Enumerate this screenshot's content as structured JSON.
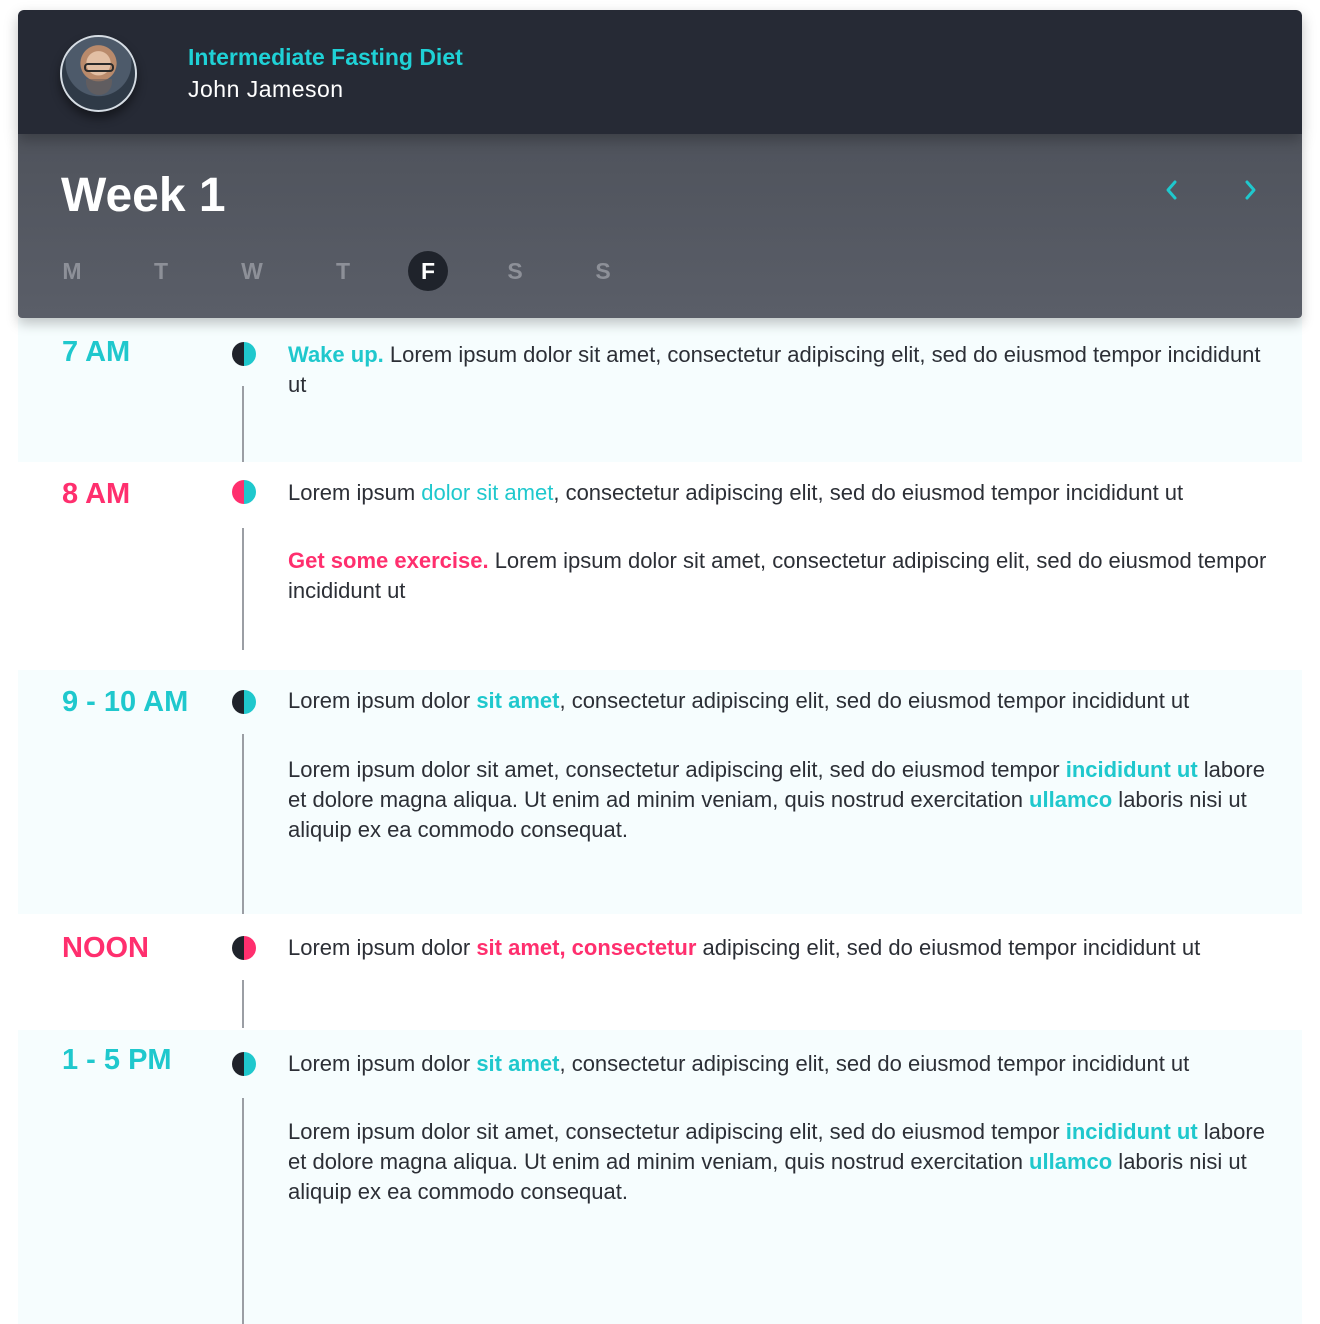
{
  "header": {
    "title": "Intermediate Fasting Diet",
    "name": "John Jameson"
  },
  "week": {
    "title": "Week 1",
    "days": [
      "M",
      "T",
      "W",
      "T",
      "F",
      "S",
      "S"
    ],
    "active_day": "F"
  },
  "colors": {
    "teal": "#1fc8cd",
    "pink": "#ff2f6e",
    "dark": "#262a35"
  },
  "icons": {
    "prev": "chevron-left-icon",
    "next": "chevron-right-icon"
  },
  "schedule": {
    "r0": {
      "time": "7 AM",
      "p0": {
        "a": "Wake up.",
        "b": " Lorem ipsum dolor sit amet, consectetur adipiscing elit, sed do eiusmod tempor incididunt ut"
      }
    },
    "r1": {
      "time": "8 AM",
      "p0": {
        "a": "Lorem ipsum ",
        "b": "dolor sit amet",
        "c": ", consectetur adipiscing elit, sed do eiusmod tempor incididunt ut"
      },
      "p1": {
        "a": "Get some exercise.",
        "b": " Lorem ipsum dolor sit amet, consectetur adipiscing elit, sed do eiusmod tempor incididunt ut"
      }
    },
    "r2": {
      "time": "9 - 10 AM",
      "p0": {
        "a": "Lorem ipsum dolor ",
        "b": "sit amet",
        "c": ", consectetur adipiscing elit, sed do eiusmod tempor incididunt ut"
      },
      "p1": {
        "a": "Lorem ipsum dolor sit amet, consectetur adipiscing elit, sed do eiusmod tempor ",
        "b": "incididunt ut",
        "c": " labore et dolore magna aliqua. Ut enim ad minim veniam, quis nostrud exercitation ",
        "d": "ullamco",
        "e": " laboris nisi ut aliquip ex ea commodo consequat."
      }
    },
    "r3": {
      "time": "NOON",
      "p0": {
        "a": "Lorem ipsum dolor ",
        "b": "sit amet, consectetur",
        "c": " adipiscing elit, sed do eiusmod tempor incididunt ut"
      }
    },
    "r4": {
      "time": "1 - 5 PM",
      "p0": {
        "a": "Lorem ipsum dolor ",
        "b": "sit amet",
        "c": ", consectetur adipiscing elit, sed do eiusmod tempor incididunt ut"
      },
      "p1": {
        "a": "Lorem ipsum dolor sit amet, consectetur adipiscing elit, sed do eiusmod tempor ",
        "b": "incididunt ut",
        "c": " labore et dolore magna aliqua. Ut enim ad minim veniam, quis nostrud exercitation ",
        "d": "ullamco",
        "e": " laboris nisi ut aliquip ex ea commodo consequat."
      }
    }
  }
}
